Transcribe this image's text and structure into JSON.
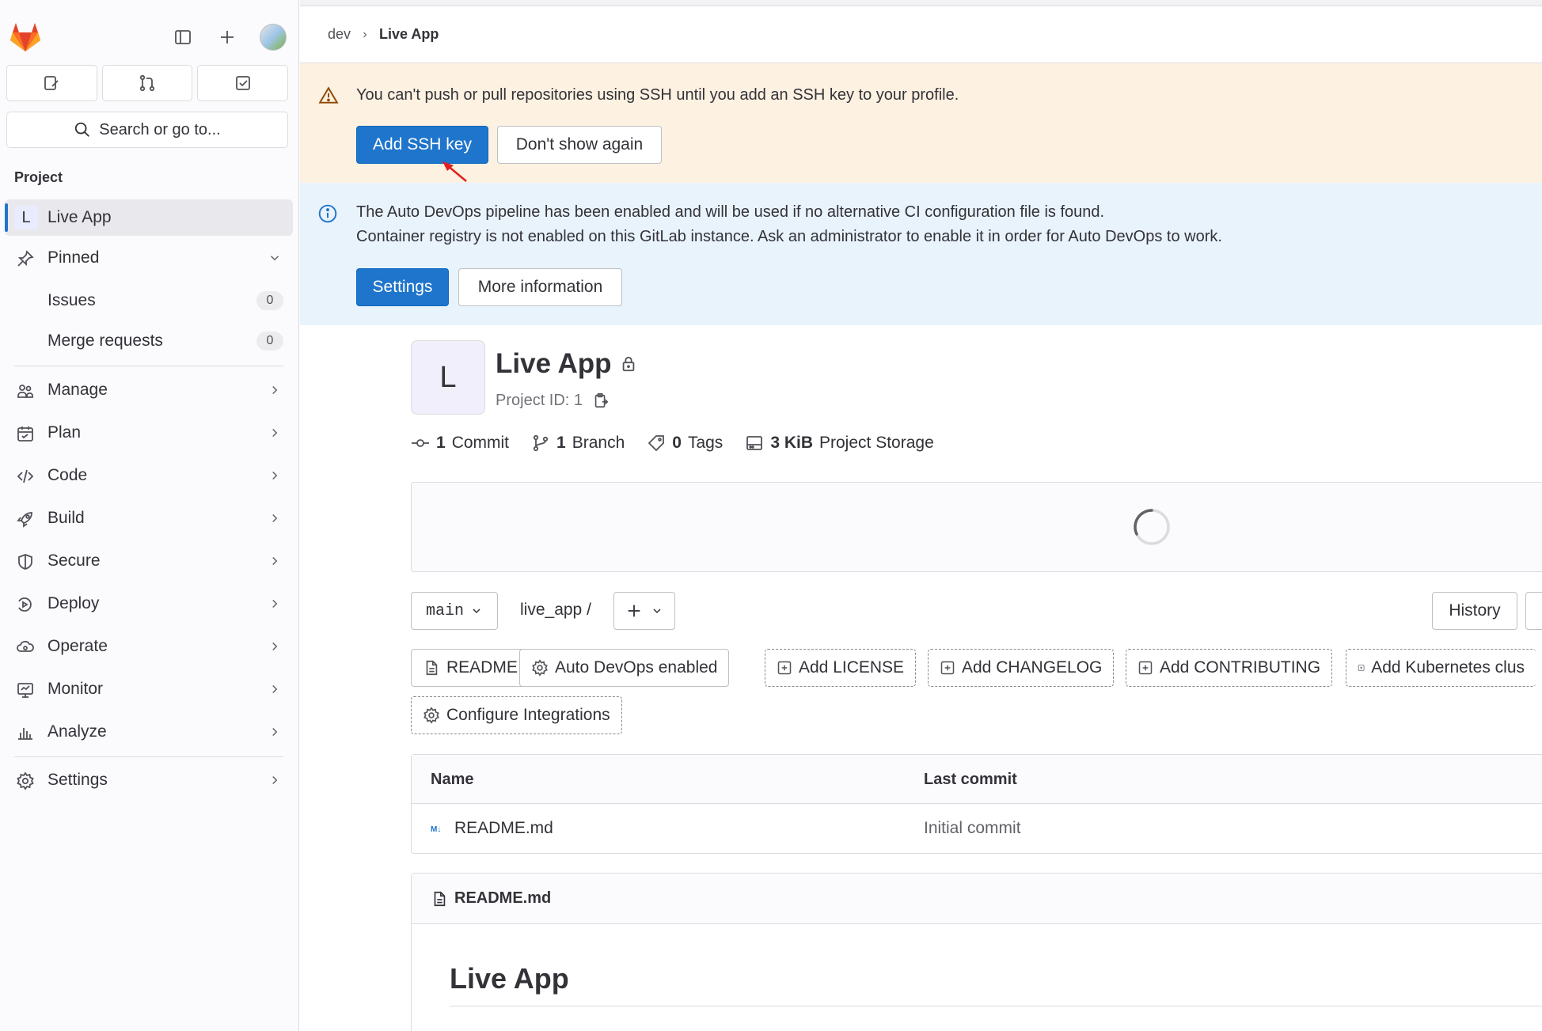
{
  "sidebar": {
    "quick_actions": [
      "issues-icon",
      "merge-requests-icon",
      "todo-icon"
    ],
    "search_placeholder": "Search or go to...",
    "section_label": "Project",
    "project": {
      "letter": "L",
      "name": "Live App"
    },
    "pinned": {
      "label": "Pinned",
      "items": [
        {
          "label": "Issues",
          "count": "0"
        },
        {
          "label": "Merge requests",
          "count": "0"
        }
      ]
    },
    "menu": [
      {
        "label": "Manage",
        "icon": "users-icon"
      },
      {
        "label": "Plan",
        "icon": "calendar-icon"
      },
      {
        "label": "Code",
        "icon": "code-icon"
      },
      {
        "label": "Build",
        "icon": "rocket-icon"
      },
      {
        "label": "Secure",
        "icon": "shield-icon"
      },
      {
        "label": "Deploy",
        "icon": "deploy-icon"
      },
      {
        "label": "Operate",
        "icon": "cloud-gear-icon"
      },
      {
        "label": "Monitor",
        "icon": "monitor-icon"
      },
      {
        "label": "Analyze",
        "icon": "chart-icon"
      }
    ],
    "settings_label": "Settings"
  },
  "breadcrumb": {
    "root": "dev",
    "current": "Live App"
  },
  "ssh_alert": {
    "message": "You can't push or pull repositories using SSH until you add an SSH key to your profile.",
    "primary": "Add SSH key",
    "secondary": "Don't show again"
  },
  "devops_alert": {
    "line1": "The Auto DevOps pipeline has been enabled and will be used if no alternative CI configuration file is found.",
    "line2": "Container registry is not enabled on this GitLab instance. Ask an administrator to enable it in order for Auto DevOps to work.",
    "primary": "Settings",
    "secondary": "More information"
  },
  "project": {
    "letter": "L",
    "title": "Live App",
    "id_text": "Project ID: 1",
    "stats": [
      {
        "value": "1",
        "label": "Commit",
        "icon": "commit-icon"
      },
      {
        "value": "1",
        "label": "Branch",
        "icon": "branch-icon"
      },
      {
        "value": "0",
        "label": "Tags",
        "icon": "tag-icon"
      },
      {
        "value": "3 KiB",
        "label": "Project Storage",
        "icon": "storage-icon"
      }
    ]
  },
  "repo": {
    "branch": "main",
    "path": "live_app",
    "path_sep": "/",
    "history": "History"
  },
  "shortcuts": [
    {
      "label": "README",
      "style": "solid",
      "icon": "file-icon"
    },
    {
      "label": "Auto DevOps enabled",
      "style": "solid",
      "icon": "gear-icon"
    },
    {
      "label": "Add LICENSE",
      "style": "dashed",
      "icon": "plus-square-icon"
    },
    {
      "label": "Add CHANGELOG",
      "style": "dashed",
      "icon": "plus-square-icon"
    },
    {
      "label": "Add CONTRIBUTING",
      "style": "dashed",
      "icon": "plus-square-icon"
    },
    {
      "label": "Add Kubernetes clus",
      "style": "dashed",
      "icon": "plus-square-icon"
    },
    {
      "label": "Configure Integrations",
      "style": "dashed",
      "icon": "gear-icon"
    }
  ],
  "files": {
    "headers": {
      "name": "Name",
      "last_commit": "Last commit"
    },
    "rows": [
      {
        "name": "README.md",
        "commit": "Initial commit"
      }
    ]
  },
  "readme": {
    "filename": "README.md",
    "heading": "Live App"
  },
  "colors": {
    "primary": "#1f75cb",
    "warning_bg": "#fdf1e1",
    "info_bg": "#e9f3fc",
    "brand": "#e24329"
  }
}
